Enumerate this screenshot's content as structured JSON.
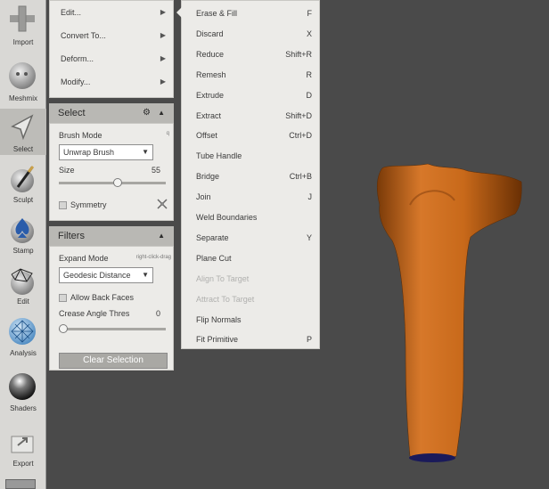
{
  "toolbar": {
    "items": [
      {
        "label": "Import",
        "icon": "plus-icon"
      },
      {
        "label": "Meshmix",
        "icon": "meshmix-sphere-icon"
      },
      {
        "label": "Select",
        "icon": "select-arrow-icon"
      },
      {
        "label": "Sculpt",
        "icon": "sculpt-brush-icon"
      },
      {
        "label": "Stamp",
        "icon": "stamp-icon"
      },
      {
        "label": "Edit",
        "icon": "edit-mesh-icon"
      },
      {
        "label": "Analysis",
        "icon": "analysis-icon"
      },
      {
        "label": "Shaders",
        "icon": "shaders-sphere-icon"
      },
      {
        "label": "Export",
        "icon": "export-icon"
      }
    ]
  },
  "menu": {
    "items": [
      {
        "label": "Edit..."
      },
      {
        "label": "Convert To..."
      },
      {
        "label": "Deform..."
      },
      {
        "label": "Modify..."
      }
    ]
  },
  "select_panel": {
    "title": "Select",
    "brush_mode_label": "Brush Mode",
    "brush_mode_hint": "q",
    "brush_mode_value": "Unwrap Brush",
    "size_label": "Size",
    "size_value": "55",
    "size_fraction": 0.55,
    "symmetry_label": "Symmetry"
  },
  "filters_panel": {
    "title": "Filters",
    "expand_mode_label": "Expand Mode",
    "expand_mode_hint": "right-click-drag",
    "expand_mode_value": "Geodesic Distance",
    "allow_back_faces_label": "Allow Back Faces",
    "crease_angle_label": "Crease Angle Thres",
    "crease_angle_value": "0",
    "crease_fraction": 0.0,
    "clear_selection_label": "Clear Selection"
  },
  "submenu": {
    "items": [
      {
        "label": "Erase & Fill",
        "shortcut": "F",
        "enabled": true
      },
      {
        "label": "Discard",
        "shortcut": "X",
        "enabled": true
      },
      {
        "label": "Reduce",
        "shortcut": "Shift+R",
        "enabled": true
      },
      {
        "label": "Remesh",
        "shortcut": "R",
        "enabled": true
      },
      {
        "label": "Extrude",
        "shortcut": "D",
        "enabled": true
      },
      {
        "label": "Extract",
        "shortcut": "Shift+D",
        "enabled": true
      },
      {
        "label": "Offset",
        "shortcut": "Ctrl+D",
        "enabled": true
      },
      {
        "label": "Tube Handle",
        "shortcut": "",
        "enabled": true
      },
      {
        "label": "Bridge",
        "shortcut": "Ctrl+B",
        "enabled": true
      },
      {
        "label": "Join",
        "shortcut": "J",
        "enabled": true
      },
      {
        "label": "Weld Boundaries",
        "shortcut": "",
        "enabled": true
      },
      {
        "label": "Separate",
        "shortcut": "Y",
        "enabled": true
      },
      {
        "label": "Plane Cut",
        "shortcut": "",
        "enabled": true
      },
      {
        "label": "Align To Target",
        "shortcut": "",
        "enabled": false
      },
      {
        "label": "Attract To Target",
        "shortcut": "",
        "enabled": false
      },
      {
        "label": "Flip Normals",
        "shortcut": "",
        "enabled": true
      },
      {
        "label": "Fit Primitive",
        "shortcut": "P",
        "enabled": true
      }
    ]
  },
  "colors": {
    "viewport_bg": "#4a4a4a",
    "model": "#c8691a",
    "panel": "#ecebe8",
    "section_header": "#b9b8b4"
  }
}
